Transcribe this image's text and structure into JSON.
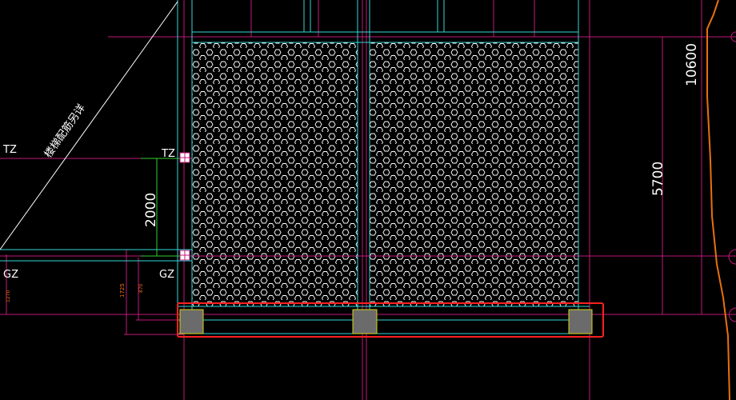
{
  "colors": {
    "background": "#000000",
    "magenta": "#c2187a",
    "cyan": "#33d6d6",
    "white": "#ffffff",
    "green": "#2fd12f",
    "red": "#ff2020",
    "orange": "#e8700f",
    "column_fill": "#6b6b6b",
    "column_stroke": "#d6d616",
    "hatch": "#ffffff"
  },
  "labels": {
    "tz_left": "TZ",
    "tz_right": "TZ",
    "gz_left": "GZ",
    "gz_right": "GZ",
    "stair_note": "楼梯配筋另详"
  },
  "dimensions": {
    "elevation_top": "10600",
    "elevation_mid": "5700",
    "stair_height": "2000",
    "small_a": "1725",
    "small_b": "1270",
    "small_c": "870"
  },
  "highlight": {
    "type": "selection-rectangle",
    "color": "#ff2020",
    "covers": "bottom beam with three columns"
  }
}
